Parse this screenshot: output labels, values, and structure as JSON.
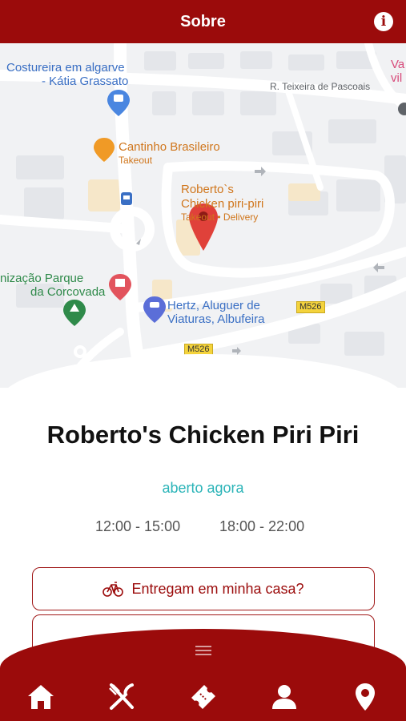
{
  "header": {
    "title": "Sobre",
    "info_icon": "info-icon"
  },
  "map": {
    "labels": {
      "costureira_1": "Costureira em algarve",
      "costureira_2": "- Kátia Grassato",
      "street_teixeira": "R. Teixeira de Pascoais",
      "cantinho": "Cantinho Brasileiro",
      "cantinho_sub": "Takeout",
      "robertos_1": "Roberto`s",
      "robertos_2": "Chicken piri-piri",
      "robertos_sub": "Takeout • Delivery",
      "parque_1": "nização Parque",
      "parque_2": "da Corcovada",
      "hertz_1": "Hertz, Aluguer de",
      "hertz_2": "Viaturas, Albufeira",
      "edge_1": "Va",
      "edge_2": "vil",
      "road_1": "M526",
      "road_2": "M526"
    }
  },
  "place": {
    "name": "Roberto's Chicken Piri Piri",
    "status": "aberto agora",
    "hours": [
      "12:00 - 15:00",
      "18:00 - 22:00"
    ]
  },
  "buttons": {
    "delivery": "Entregam em minha casa?"
  },
  "nav": {
    "items": [
      "home-icon",
      "restaurant-icon",
      "ticket-icon",
      "user-icon",
      "location-icon"
    ]
  },
  "colors": {
    "brand": "#9b0b0b",
    "status": "#2bb4b8"
  }
}
